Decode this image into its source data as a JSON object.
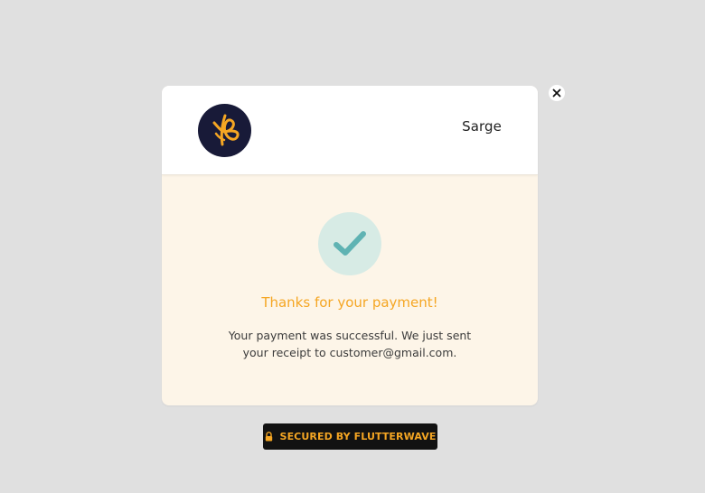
{
  "merchant": {
    "name": "Sarge"
  },
  "status": {
    "title": "Thanks for your payment!",
    "message": "Your payment was successful. We just sent your receipt to customer@gmail.com."
  },
  "footer": {
    "secured_label": "SECURED BY FLUTTERWAVE"
  },
  "icons": {
    "close": "close-icon",
    "check": "checkmark-icon",
    "lock": "lock-icon",
    "logo": "merchant-logo"
  },
  "colors": {
    "accent": "#f5a623",
    "success_bg": "#d7ebe5",
    "success_check": "#5fb3b3",
    "panel_bg": "#fdf5e8",
    "logo_bg": "#181a38"
  }
}
